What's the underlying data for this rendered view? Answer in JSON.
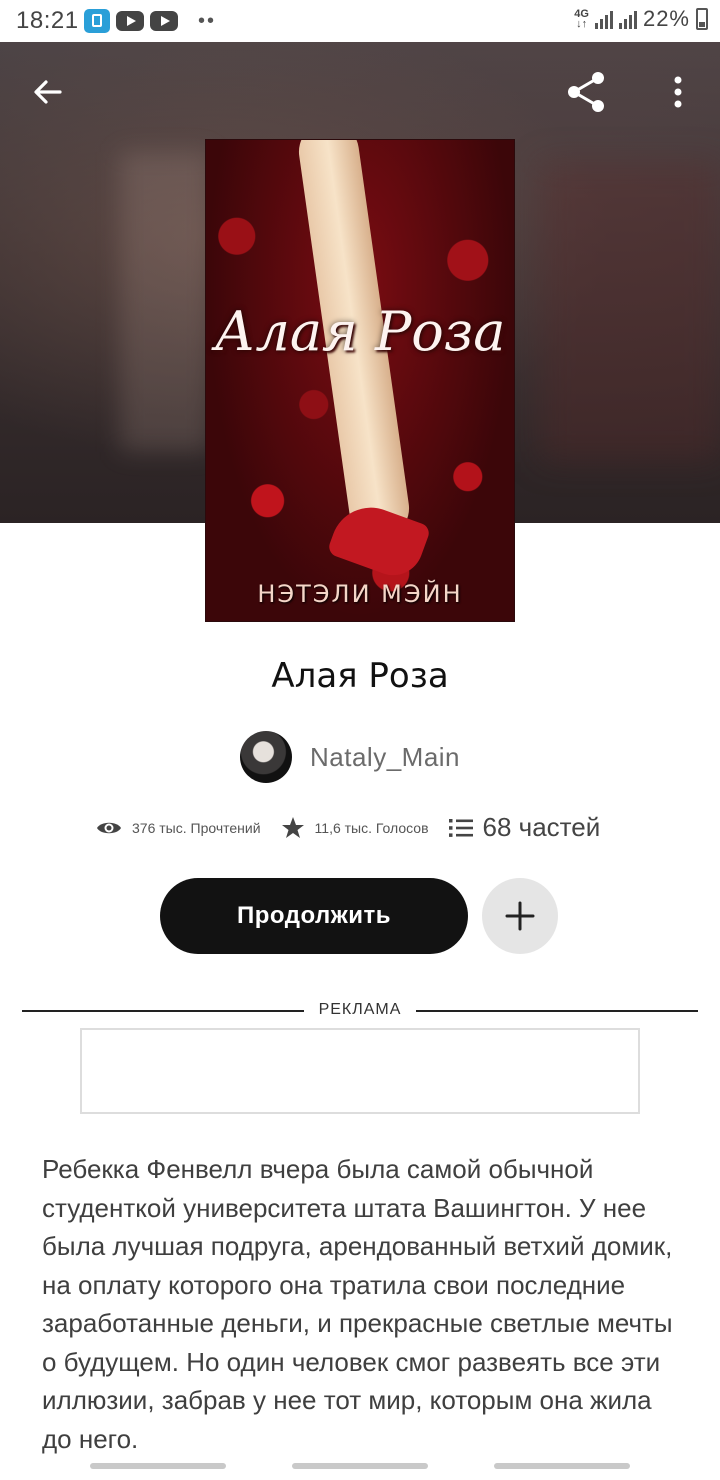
{
  "status_bar": {
    "time": "18:21",
    "network": "4G",
    "battery": "22%"
  },
  "book": {
    "cover_title": "Алая Роза",
    "cover_author": "НЭТЭЛИ МЭЙН",
    "title": "Алая Роза",
    "author": "Nataly_Main"
  },
  "stats": {
    "reads": "376 тыс. Прочтений",
    "votes": "11,6 тыс. Голосов",
    "parts": "68 частей"
  },
  "actions": {
    "continue_label": "Продолжить",
    "add_label": "+"
  },
  "ad": {
    "label": "РЕКЛАМА"
  },
  "description": "Ребекка Фенвелл вчера была самой обычной студенткой университета штата Вашингтон. У нее была лучшая подруга, арендованный ветхий домик, на оплату которого она тратила свои последние заработанные деньги, и прекрасные светлые мечты о будущем. Но один человек смог развеять все эти иллюзии, забрав у нее тот мир, которым она жила до него.",
  "icons": {
    "back": "arrow-left-icon",
    "share": "share-icon",
    "more": "more-vertical-icon",
    "reads": "eye-icon",
    "votes": "star-icon",
    "parts": "list-icon",
    "add": "plus-icon"
  },
  "colors": {
    "continue_button": "#121212",
    "add_button": "#e5e5e5",
    "text": "#3f3f3f"
  }
}
